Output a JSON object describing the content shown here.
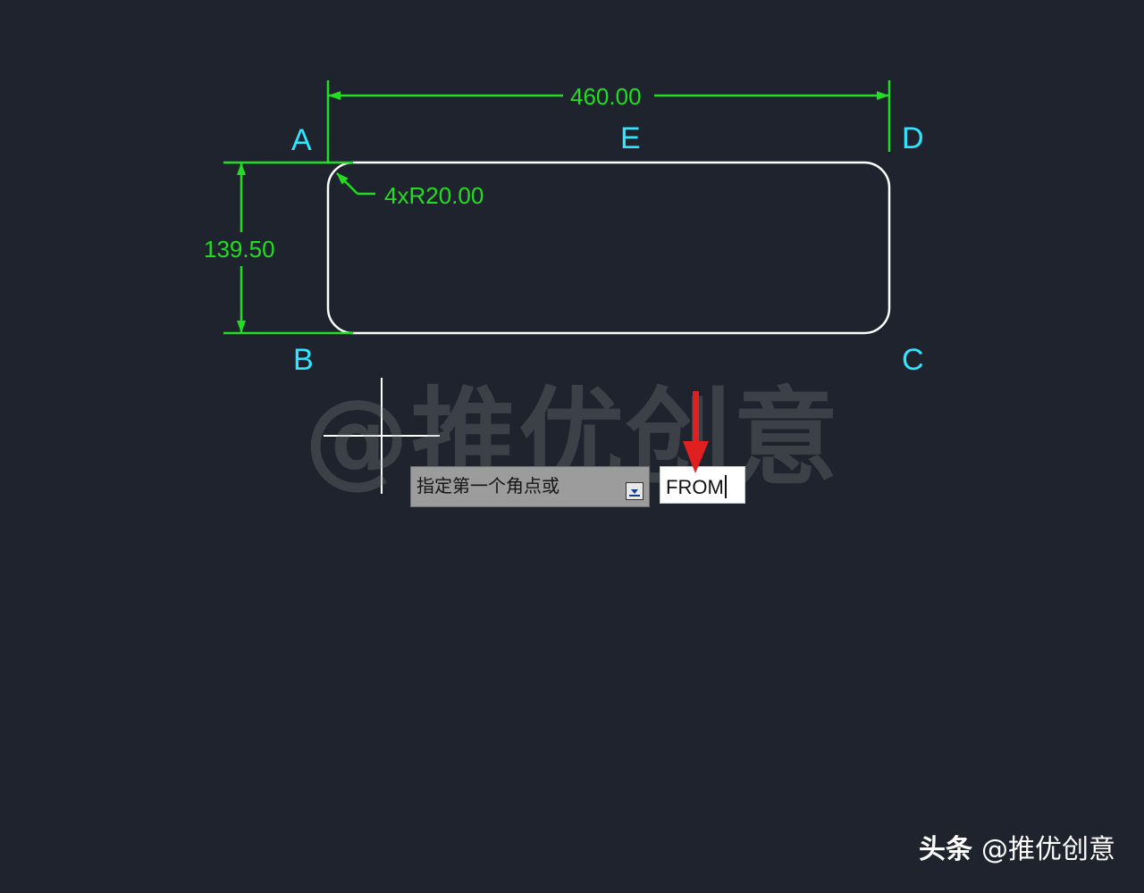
{
  "drawing": {
    "points": {
      "a": "A",
      "b": "B",
      "c": "C",
      "d": "D",
      "e": "E"
    },
    "dimensions": {
      "width": "460.00",
      "height": "139.50",
      "radius": "4xR20.00"
    },
    "colors": {
      "background": "#1e232d",
      "dimension": "#22dd22",
      "point_label": "#2ee6ff",
      "geometry": "#ffffff",
      "marker_arrow": "#e02020"
    }
  },
  "watermark": "@推优创意",
  "command": {
    "prompt": "指定第一个角点或",
    "prompt_icon": "dropdown-arrow-icon",
    "input_value": "FROM"
  },
  "footer": {
    "brand": "头条",
    "account": "@推优创意"
  }
}
